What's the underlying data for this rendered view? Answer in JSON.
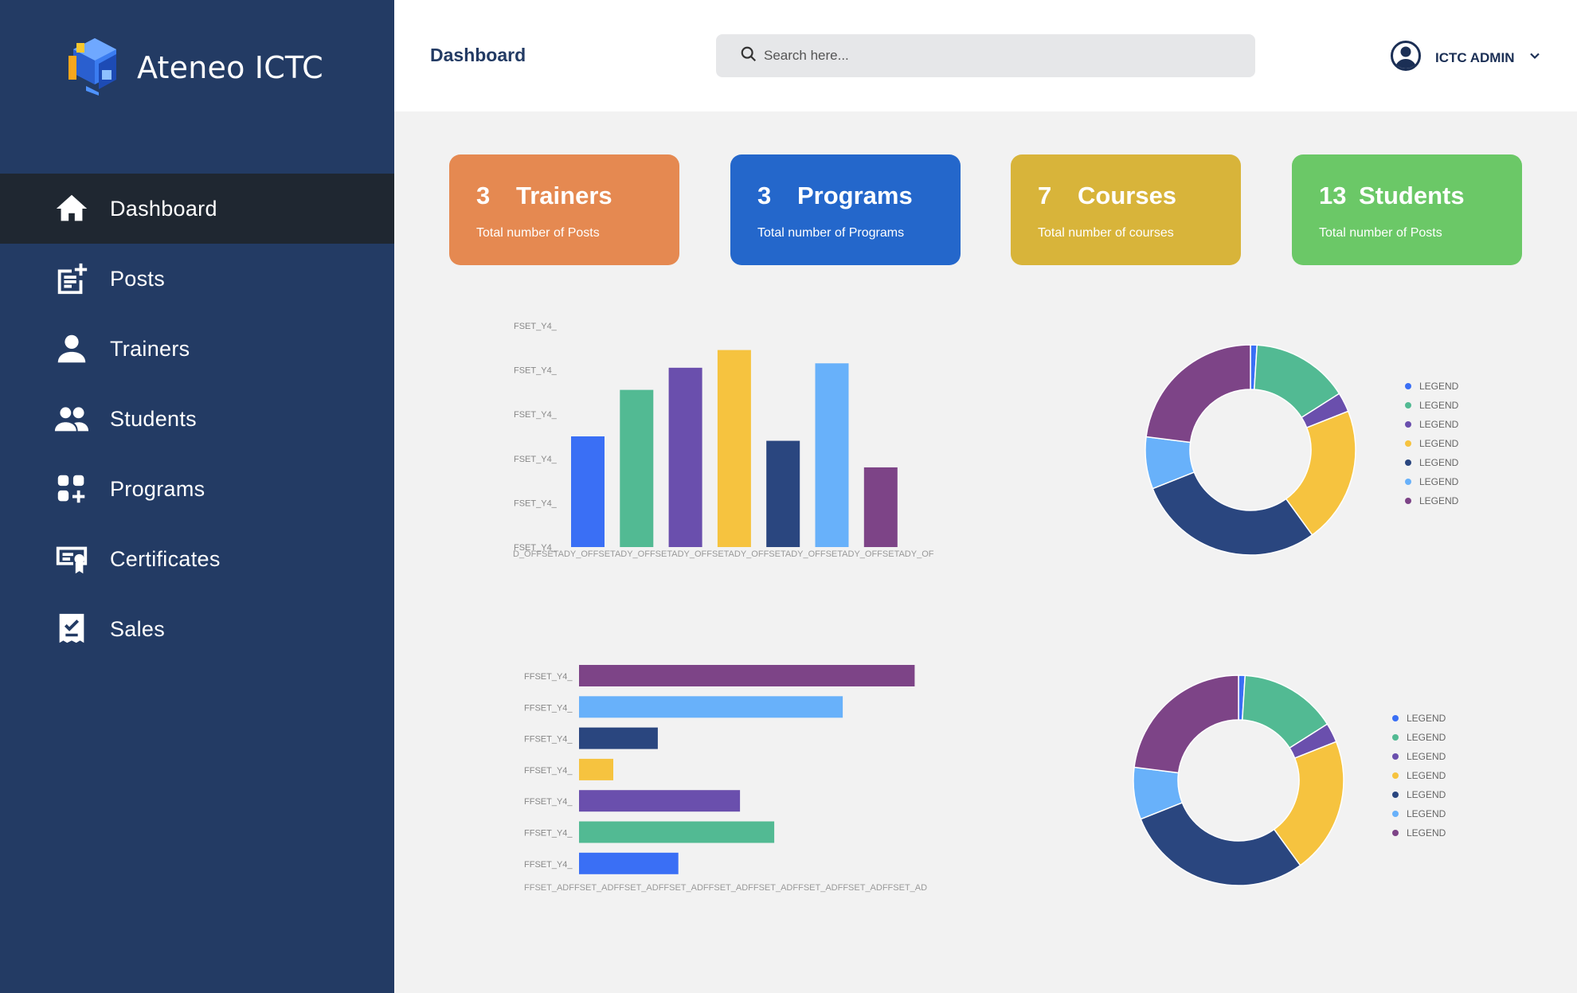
{
  "app": {
    "name": "Ateneo ICTC"
  },
  "sidebar": {
    "items": [
      {
        "label": "Dashboard",
        "icon": "home-icon",
        "active": true
      },
      {
        "label": "Posts",
        "icon": "post-add-icon",
        "active": false
      },
      {
        "label": "Trainers",
        "icon": "person-icon",
        "active": false
      },
      {
        "label": "Students",
        "icon": "group-icon",
        "active": false
      },
      {
        "label": "Programs",
        "icon": "apps-add-icon",
        "active": false
      },
      {
        "label": "Certificates",
        "icon": "certificate-icon",
        "active": false
      },
      {
        "label": "Sales",
        "icon": "receipt-check-icon",
        "active": false
      }
    ]
  },
  "header": {
    "title": "Dashboard",
    "search_placeholder": "Search here...",
    "user_name": "ICTC ADMIN"
  },
  "cards": [
    {
      "count": "3",
      "title": "Trainers",
      "subtitle": "Total number of Posts",
      "color": "#e58951"
    },
    {
      "count": "3",
      "title": "Programs",
      "subtitle": "Total number of Programs",
      "color": "#2467cb"
    },
    {
      "count": "7",
      "title": "Courses",
      "subtitle": "Total number of courses",
      "color": "#d8b43a"
    },
    {
      "count": "13",
      "title": "Students",
      "subtitle": "Total number of Posts",
      "color": "#6bc867"
    }
  ],
  "palette": [
    "#3a6ff5",
    "#52ba93",
    "#6a4fad",
    "#f6c33f",
    "#2a467f",
    "#68b1fa",
    "#7d4487"
  ],
  "chart_data": [
    {
      "type": "bar",
      "orientation": "vertical",
      "y_tick_labels": [
        "FSET_Y4_",
        "FSET_Y4_",
        "FSET_Y4_",
        "FSET_Y4_",
        "FSET_Y4_",
        "FSET_Y4_"
      ],
      "x_tick_text": "D_OFFSETADY_OFFSETADY_OFFSETADY_OFFSETADY_OFFSETADY_OFFSETADY_OFFSETADY_OF",
      "values": [
        50,
        71,
        81,
        89,
        48,
        83,
        36
      ],
      "ylim": [
        0,
        100
      ]
    },
    {
      "type": "pie",
      "values": [
        1,
        15,
        3,
        21,
        29,
        8,
        23
      ],
      "legend": [
        "LEGEND",
        "LEGEND",
        "LEGEND",
        "LEGEND",
        "LEGEND",
        "LEGEND",
        "LEGEND"
      ],
      "legend_position": "right"
    },
    {
      "type": "bar",
      "orientation": "horizontal",
      "y_tick_labels": [
        "FFSET_Y4_",
        "FFSET_Y4_",
        "FFSET_Y4_",
        "FFSET_Y4_",
        "FFSET_Y4_",
        "FFSET_Y4_",
        "FFSET_Y4_"
      ],
      "x_tick_text": "FFSET_ADFFSET_ADFFSET_ADFFSET_ADFFSET_ADFFSET_ADFFSET_ADFFSET_ADFFSET_AD",
      "values": [
        98,
        77,
        23,
        10,
        47,
        57,
        29
      ],
      "series_colors": [
        "#7d4487",
        "#68b1fa",
        "#2a467f",
        "#f6c33f",
        "#6a4fad",
        "#52ba93",
        "#3a6ff5"
      ],
      "xlim": [
        0,
        100
      ]
    },
    {
      "type": "pie",
      "values": [
        1,
        15,
        3,
        21,
        29,
        8,
        23
      ],
      "legend": [
        "LEGEND",
        "LEGEND",
        "LEGEND",
        "LEGEND",
        "LEGEND",
        "LEGEND",
        "LEGEND"
      ],
      "legend_position": "right"
    }
  ]
}
